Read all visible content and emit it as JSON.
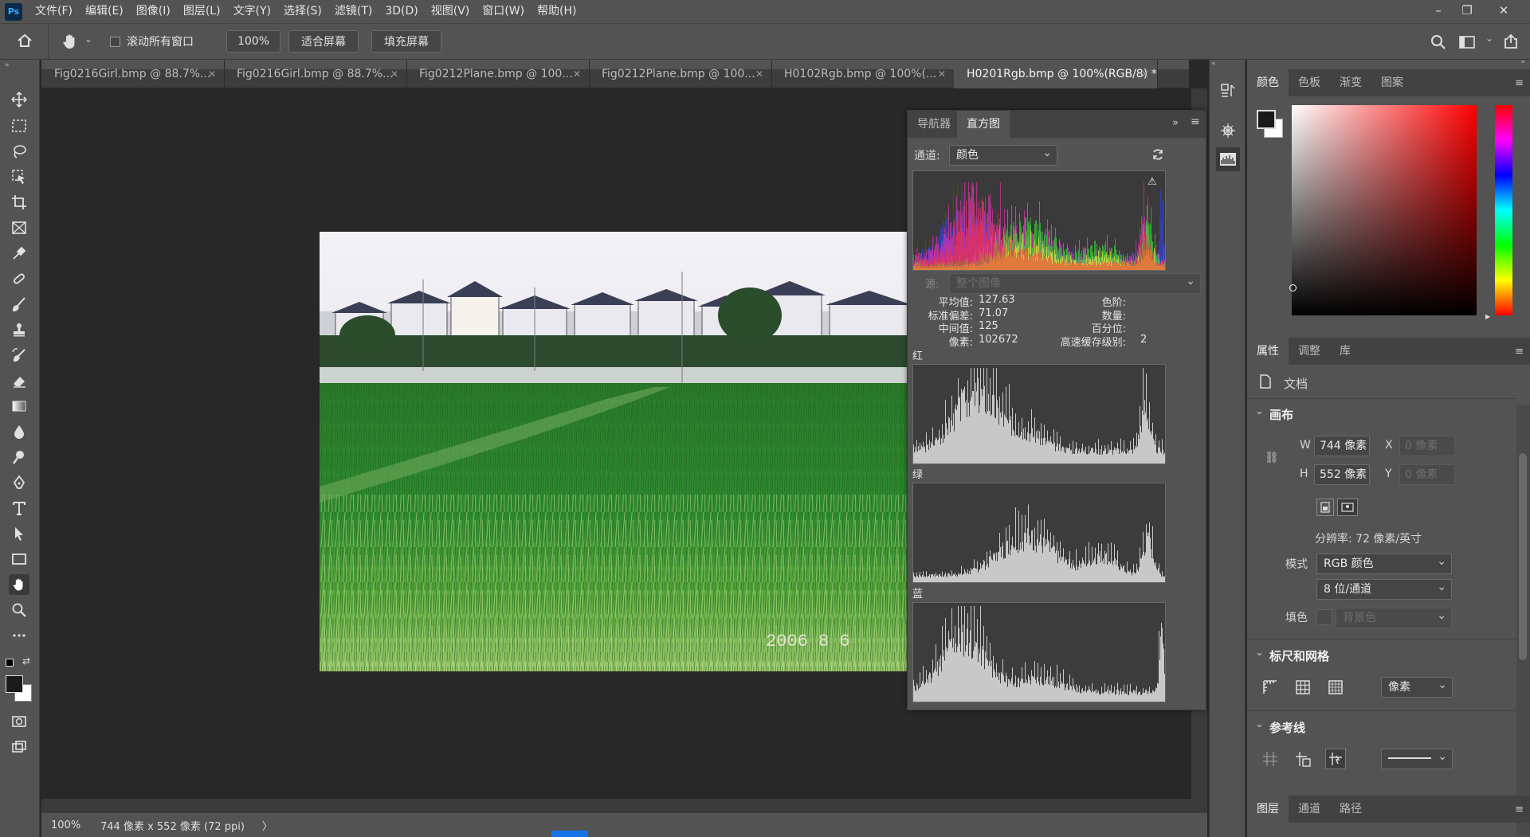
{
  "app": {
    "logo": "Ps"
  },
  "menu": [
    "文件(F)",
    "编辑(E)",
    "图像(I)",
    "图层(L)",
    "文字(Y)",
    "选择(S)",
    "滤镜(T)",
    "3D(D)",
    "视图(V)",
    "窗口(W)",
    "帮助(H)"
  ],
  "window_controls": {
    "minimize": "–",
    "restore": "❐",
    "close": "✕"
  },
  "options_bar": {
    "scroll_all_label": "滚动所有窗口",
    "zoom_value": "100%",
    "fit_screen": "适合屏幕",
    "fill_screen": "填充屏幕"
  },
  "tabs": [
    {
      "label": "Fig0216Girl.bmp @ 88.7%..."
    },
    {
      "label": "Fig0216Girl.bmp @ 88.7%..."
    },
    {
      "label": "Fig0212Plane.bmp @ 100..."
    },
    {
      "label": "Fig0212Plane.bmp @ 100..."
    },
    {
      "label": "H0102Rgb.bmp @ 100%(..."
    },
    {
      "label": "H0201Rgb.bmp @ 100%(RGB/8) *"
    }
  ],
  "photo": {
    "date_stamp": "2006  8  6"
  },
  "status": {
    "zoom": "100%",
    "size": "744 像素 x 552 像素 (72 ppi)",
    "arrow": "〉"
  },
  "histogram": {
    "tabs": [
      "导航器",
      "直方图"
    ],
    "channel_label": "通道:",
    "channel_value": "颜色",
    "source_label": "源:",
    "source_value": "整个图像",
    "stats": {
      "mean_label": "平均值:",
      "mean": "127.63",
      "std_label": "标准偏差:",
      "std": "71.07",
      "median_label": "中间值:",
      "median": "125",
      "pixels_label": "像素:",
      "pixels": "102672",
      "level_label": "色阶:",
      "count_label": "数量:",
      "percentile_label": "百分位:",
      "cache_label": "高速缓存级别:",
      "cache": "2"
    },
    "channels": [
      "红",
      "绿",
      "蓝"
    ]
  },
  "color_panel": {
    "tabs": [
      "颜色",
      "色板",
      "渐变",
      "图案"
    ]
  },
  "properties": {
    "tabs": [
      "属性",
      "调整",
      "库"
    ],
    "doc_label": "文档",
    "canvas_title": "画布",
    "w_label": "W",
    "w_value": "744 像素",
    "h_label": "H",
    "h_value": "552 像素",
    "x_label": "X",
    "x_placeholder": "0 像素",
    "y_label": "Y",
    "y_placeholder": "0 像素",
    "resolution": "分辨率: 72 像素/英寸",
    "mode_label": "模式",
    "mode_value": "RGB 颜色",
    "depth_value": "8 位/通道",
    "fill_label": "填色",
    "fill_value": "背景色",
    "rulers_title": "标尺和网格",
    "unit_value": "像素",
    "guides_title": "参考线"
  },
  "layers_panel": {
    "tabs": [
      "图层",
      "通道",
      "路径"
    ]
  },
  "colors": {
    "accent": "#1473e6",
    "ui_bg": "#535353",
    "canvas_bg": "#282828"
  }
}
